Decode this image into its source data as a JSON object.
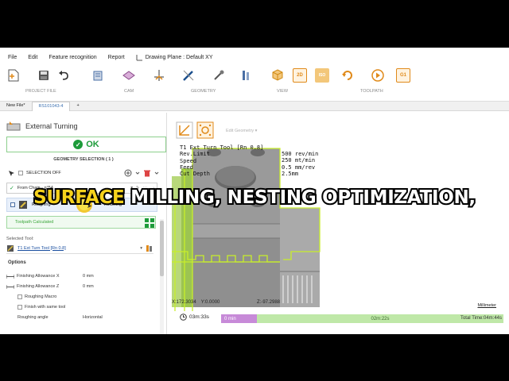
{
  "menu": [
    "File",
    "Edit",
    "Feature recognition",
    "Report",
    "Drawing Plane : Default XY"
  ],
  "ribbon_groups": [
    {
      "label": "PROJECT FILE"
    },
    {
      "label": "CAM"
    },
    {
      "label": "GEOMETRY"
    },
    {
      "label": "VIEW"
    },
    {
      "label": "TOOLPATH"
    }
  ],
  "ribbon_icons": {
    "twod": "2D",
    "iso": "ISO",
    "g1": "G1"
  },
  "tabs": [
    {
      "label": "New File*"
    },
    {
      "label": "RS101043-4"
    },
    {
      "label": "+"
    }
  ],
  "panel": {
    "title": "External Turning",
    "ok_label": "OK",
    "geometry_selection": "GEOMETRY SELECTION ( 1 )",
    "selection_off": "SELECTION OFF",
    "chain_label": "From Chain  - n°54",
    "op_roughing": "Roughing",
    "op_finishing": "Finishing",
    "toolpath_calculated": "Toolpath Calculated",
    "selected_tool_label": "Selected Tool:",
    "tool_name": "T1 Ext Turn Tool  [Rn 0.8]",
    "options_label": "Options",
    "options": [
      {
        "label": "Finishing Allowance X",
        "value": "0 mm",
        "icon": true,
        "checkbox": false
      },
      {
        "label": "Finishing Allowance Z",
        "value": "0 mm",
        "icon": true,
        "checkbox": false
      },
      {
        "label": "Roughing Macro",
        "value": "",
        "icon": false,
        "checkbox": true
      },
      {
        "label": "Finish with same tool",
        "value": "",
        "icon": false,
        "checkbox": true
      },
      {
        "label": "Roughing angle",
        "value": "Horizontal",
        "icon": false,
        "checkbox": false
      }
    ]
  },
  "viewport": {
    "edit_geometry": "Edit Geometry",
    "tool_info": [
      "T1 Ext Turn Tool  [Rn 0.8]",
      "Rev.Limit",
      "Speed",
      "Feed",
      "Cut Depth"
    ],
    "tool_values": [
      "",
      "500 rev/min",
      "250 mt/min",
      "0.5 mm/rev",
      "2.5mm"
    ],
    "coord_x": "X:172.3034",
    "coord_y": "Y:0.0000",
    "coord_z": "Z:-97.2988",
    "units": "Millimeter",
    "time_total_left": "03m:33s",
    "time_seg1": "0 min",
    "time_seg2": "02m:22s",
    "time_total": "Total Time:04m:44s"
  },
  "subtitle": {
    "highlight": "SURFACE",
    "rest": " MILLING, NESTING OPTIMIZATION,"
  },
  "colors": {
    "accent": "#1d9b3a",
    "highlight_yellow": "#f5d21c",
    "toolpath": "#c8ee2b",
    "model_gray": "#8d8d8d"
  }
}
